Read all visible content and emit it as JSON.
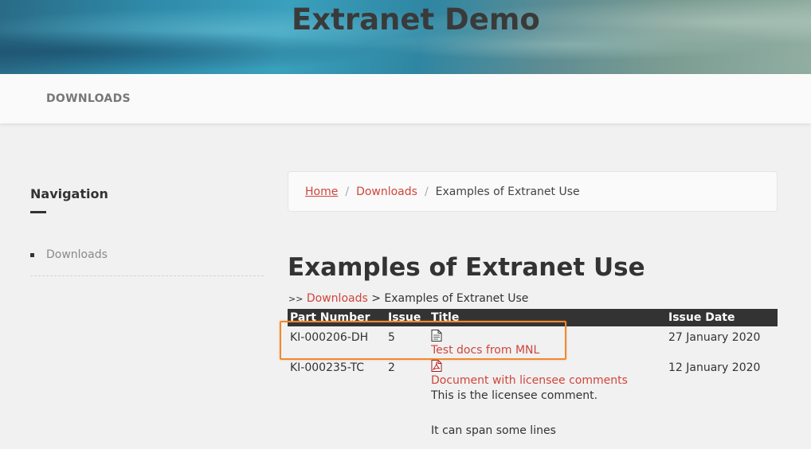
{
  "header": {
    "site_title": "Extranet Demo"
  },
  "topnav": {
    "downloads": "DOWNLOADS"
  },
  "sidebar": {
    "title": "Navigation",
    "items": [
      {
        "label": "Downloads"
      }
    ]
  },
  "breadcrumb": {
    "home": "Home",
    "downloads": "Downloads",
    "current": "Examples of Extranet Use"
  },
  "page": {
    "title": "Examples of Extranet Use",
    "path_prefix": ">>",
    "path_link": "Downloads",
    "path_rest": " > Examples of Extranet Use"
  },
  "table": {
    "headers": {
      "part_number": "Part Number",
      "issue": "Issue",
      "title": "Title",
      "issue_date": "Issue Date"
    },
    "rows": [
      {
        "part_number": "KI-000206-DH",
        "issue": "5",
        "icon": "generic-file-icon",
        "title": "Test docs from MNL",
        "issue_date": "27 January 2020"
      },
      {
        "part_number": "KI-000235-TC",
        "issue": "2",
        "icon": "pdf-file-icon",
        "title": "Document with licensee comments",
        "issue_date": "12 January 2020",
        "comment_line1": "This is the licensee comment.",
        "comment_line2": "It can span some lines"
      }
    ]
  },
  "colors": {
    "link": "#d0453b",
    "highlight": "#f0892e",
    "header_bg": "#333333"
  }
}
